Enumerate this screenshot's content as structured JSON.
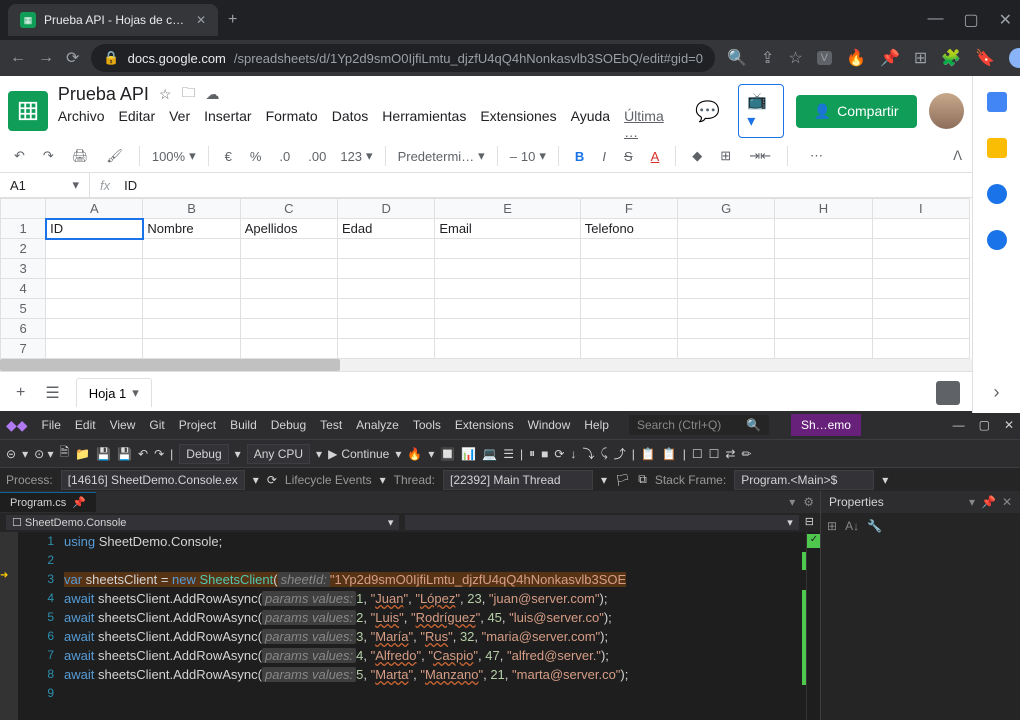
{
  "browser": {
    "tab_title": "Prueba API - Hojas de cálculo de",
    "url_domain": "docs.google.com",
    "url_path": "/spreadsheets/d/1Yp2d9smO0IjfiLmtu_djzfU4qQ4hNonkasvlb3SOEbQ/edit#gid=0"
  },
  "sheets": {
    "doc_title": "Prueba API",
    "menus": [
      "Archivo",
      "Editar",
      "Ver",
      "Insertar",
      "Formato",
      "Datos",
      "Herramientas",
      "Extensiones",
      "Ayuda"
    ],
    "last_edit": "Última …",
    "share": "Compartir",
    "toolbar": {
      "zoom": "100%",
      "currency": "€",
      "pct": "%",
      "dec0": ".0",
      "dec00": ".00",
      "numfmt": "123",
      "font": "Predetermi…",
      "size": "10"
    },
    "cell_ref": "A1",
    "fx_value": "ID",
    "cols": [
      "A",
      "B",
      "C",
      "D",
      "E",
      "F",
      "G",
      "H",
      "I"
    ],
    "rows": [
      {
        "n": "1",
        "cells": [
          "ID",
          "Nombre",
          "Apellidos",
          "Edad",
          "Email",
          "Telefono",
          "",
          "",
          ""
        ]
      },
      {
        "n": "2",
        "cells": [
          "",
          "",
          "",
          "",
          "",
          "",
          "",
          "",
          ""
        ]
      },
      {
        "n": "3",
        "cells": [
          "",
          "",
          "",
          "",
          "",
          "",
          "",
          "",
          ""
        ]
      },
      {
        "n": "4",
        "cells": [
          "",
          "",
          "",
          "",
          "",
          "",
          "",
          "",
          ""
        ]
      },
      {
        "n": "5",
        "cells": [
          "",
          "",
          "",
          "",
          "",
          "",
          "",
          "",
          ""
        ]
      },
      {
        "n": "6",
        "cells": [
          "",
          "",
          "",
          "",
          "",
          "",
          "",
          "",
          ""
        ]
      },
      {
        "n": "7",
        "cells": [
          "",
          "",
          "",
          "",
          "",
          "",
          "",
          "",
          ""
        ]
      }
    ],
    "sheet_tab": "Hoja 1"
  },
  "vs": {
    "menus": [
      "File",
      "Edit",
      "View",
      "Git",
      "Project",
      "Build",
      "Debug",
      "Test",
      "Analyze",
      "Tools",
      "Extensions",
      "Window",
      "Help"
    ],
    "search_placeholder": "Search (Ctrl+Q)",
    "mode": "Sh…emo",
    "config": "Debug",
    "platform": "Any CPU",
    "run": "Continue",
    "process_lbl": "Process:",
    "process_val": "[14616] SheetDemo.Console.ex",
    "lifecycle": "Lifecycle Events",
    "thread_lbl": "Thread:",
    "thread_val": "[22392] Main Thread",
    "stackframe_lbl": "Stack Frame:",
    "stackframe_val": "Program.<Main>$",
    "file_tab": "Program.cs",
    "crumb": "SheetDemo.Console",
    "props_title": "Properties",
    "code": {
      "sheetId": "1Yp2d9smO0IjfiLmtu_djzfU4qQ4hNonkasvlb3SOE",
      "rows": [
        {
          "n": 1,
          "v": [
            "Juan",
            "López",
            "23",
            "juan@server.com"
          ]
        },
        {
          "n": 2,
          "v": [
            "Luis",
            "Rodríguez",
            "45",
            "luis@server.co"
          ]
        },
        {
          "n": 3,
          "v": [
            "María",
            "Rus",
            "32",
            "maria@server.com"
          ]
        },
        {
          "n": 4,
          "v": [
            "Alfredo",
            "Caspio",
            "47",
            "alfred@server."
          ]
        },
        {
          "n": 5,
          "v": [
            "Marta",
            "Manzano",
            "21",
            "marta@server.co"
          ]
        }
      ]
    }
  }
}
